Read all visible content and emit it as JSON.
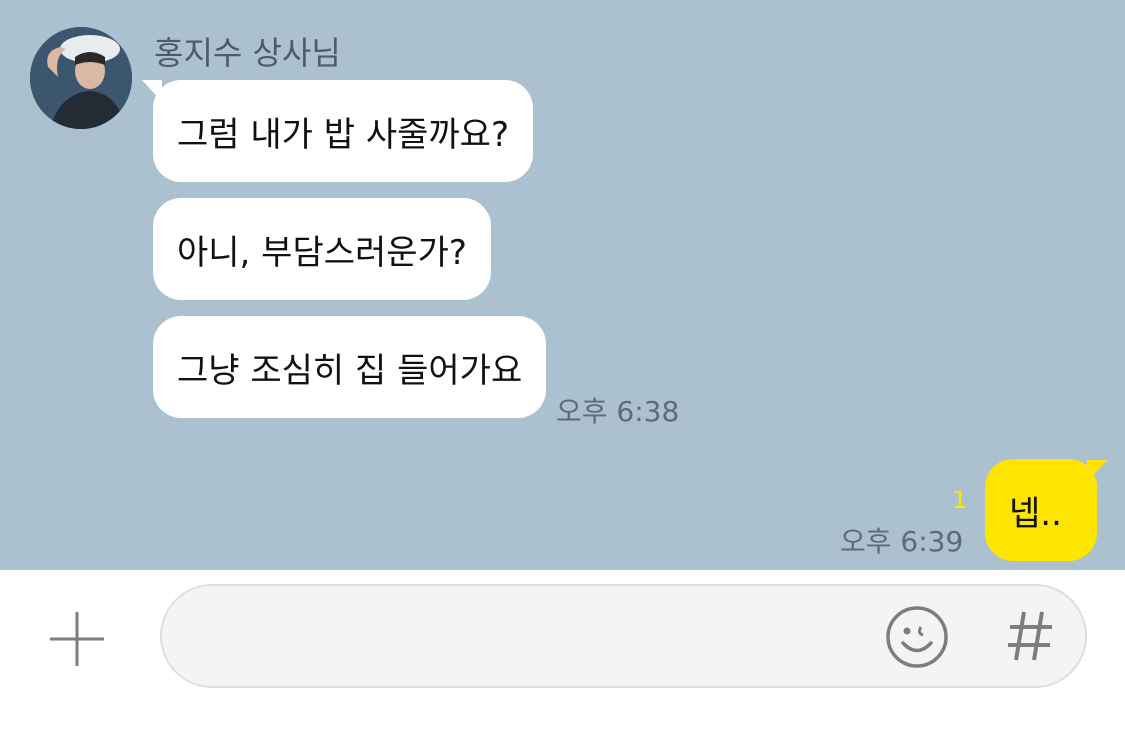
{
  "chat": {
    "sender_name": "홍지수 상사님",
    "incoming": [
      {
        "text": "그럼 내가 밥 사줄까요?"
      },
      {
        "text": "아니, 부담스러운가?"
      },
      {
        "text": "그냥 조심히 집 들어가요"
      }
    ],
    "incoming_time": "오후 6:38",
    "outgoing": {
      "text": "넵..",
      "time": "오후 6:39",
      "unread_count": "1"
    }
  },
  "input_bar": {
    "placeholder": "",
    "value": "",
    "icons": [
      "plus-icon",
      "emoticon-icon",
      "hash-icon"
    ]
  },
  "colors": {
    "chat_background": "#abc1d0",
    "incoming_bubble": "#ffffff",
    "outgoing_bubble": "#fee500",
    "unread_indicator": "#fee500"
  }
}
